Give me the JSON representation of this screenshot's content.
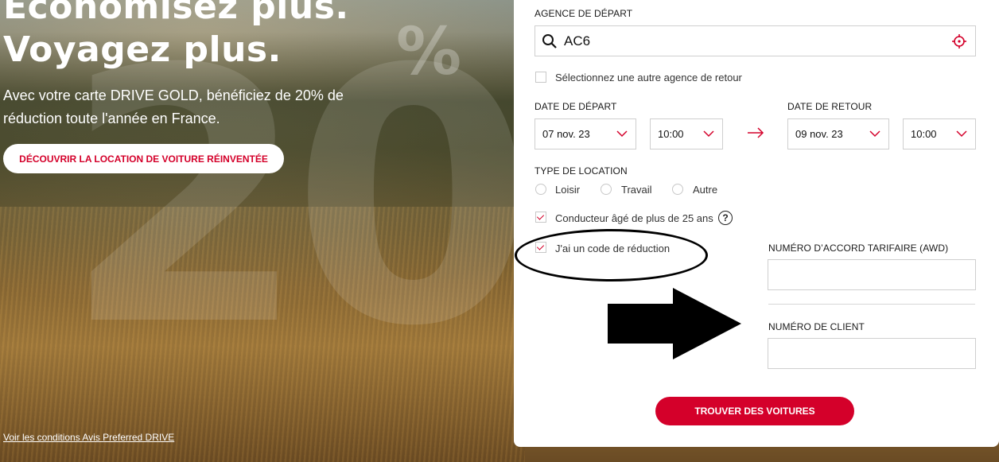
{
  "hero": {
    "title_line1": "Économisez plus.",
    "title_line2": "Voyagez plus.",
    "subtitle": "Avec votre carte DRIVE GOLD, bénéficiez de 20% de réduction toute l'année en France.",
    "cta_label": "DÉCOUVRIR LA LOCATION DE VOITURE RÉINVENTÉE",
    "terms_link": "Voir les conditions Avis Preferred DRIVE",
    "bg_number": "20",
    "bg_percent": "%"
  },
  "form": {
    "agency_label": "AGENCE DE DÉPART",
    "agency_value": "AC6",
    "return_agency_checkbox": "Sélectionnez une autre agence de retour",
    "departure_date_label": "DATE DE DÉPART",
    "departure_date": "07 nov. 23",
    "departure_time": "10:00",
    "return_date_label": "DATE DE RETOUR",
    "return_date": "09 nov. 23",
    "return_time": "10:00",
    "rental_type_label": "TYPE DE LOCATION",
    "rental_types": [
      "Loisir",
      "Travail",
      "Autre"
    ],
    "driver_age_checkbox": "Conducteur âgé de plus de 25 ans",
    "help_glyph": "?",
    "discount_checkbox": "J'ai un code de réduction",
    "awd_label": "NUMÉRO D’ACCORD TARIFAIRE (AWD)",
    "awd_value": "",
    "client_number_label": "NUMÉRO DE CLIENT",
    "client_number_value": "",
    "submit_label": "TROUVER DES VOITURES"
  },
  "colors": {
    "accent": "#d4002a",
    "panel_bg": "#ffffff",
    "annotation": "#000000"
  },
  "icons": {
    "agency_search": "search-icon",
    "agency_locate": "crosshair-icon",
    "date_arrow": "arrow-right-icon",
    "dropdown": "chevron-down-icon",
    "help": "help-icon",
    "annotation_arrow": "arrow-annotation"
  }
}
